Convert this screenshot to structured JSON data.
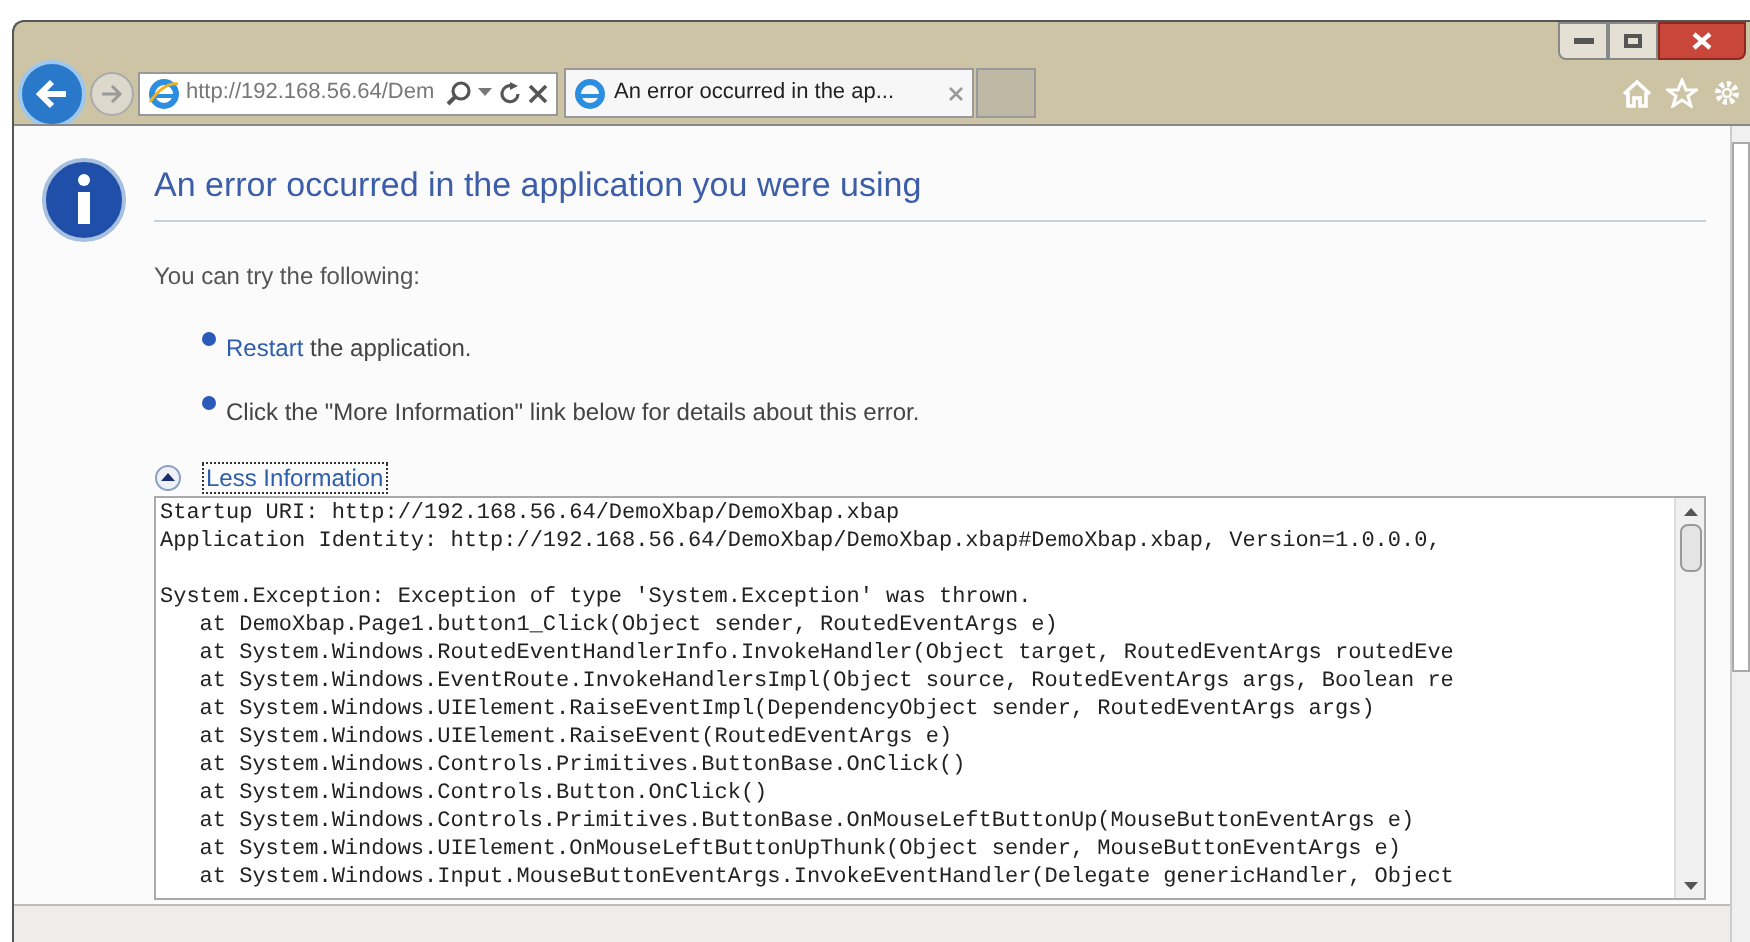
{
  "address_bar": {
    "url_host": "http://192.168.56.64/Dem"
  },
  "tabs": [
    {
      "label": "An error occurred in the ap...",
      "selected": true
    }
  ],
  "page": {
    "heading": "An error occurred in the application you were using",
    "intro": "You can try the following:",
    "suggestions": [
      {
        "link": "Restart",
        "text": " the application."
      },
      {
        "text": "Click the \"More Information\" link below for details about this error."
      }
    ],
    "toggle": {
      "label": "Less Information",
      "expanded": true
    },
    "details": [
      [
        "Startup URI: http://192.168.56.64/DemoXbap/DemoXbap.xbap",
        "Application Identity: http://192.168.56.64/DemoXbap/DemoXbap.xbap#DemoXbap.xbap, Version=1.0.0.0,"
      ],
      [
        "System.Exception: Exception of type 'System.Exception' was thrown.",
        "   at DemoXbap.Page1.button1_Click(Object sender, RoutedEventArgs e)",
        "   at System.Windows.RoutedEventHandlerInfo.InvokeHandler(Object target, RoutedEventArgs routedEve",
        "   at System.Windows.EventRoute.InvokeHandlersImpl(Object source, RoutedEventArgs args, Boolean re",
        "   at System.Windows.UIElement.RaiseEventImpl(DependencyObject sender, RoutedEventArgs args)",
        "   at System.Windows.UIElement.RaiseEvent(RoutedEventArgs e)",
        "   at System.Windows.Controls.Primitives.ButtonBase.OnClick()",
        "   at System.Windows.Controls.Button.OnClick()",
        "   at System.Windows.Controls.Primitives.ButtonBase.OnMouseLeftButtonUp(MouseButtonEventArgs e)",
        "   at System.Windows.UIElement.OnMouseLeftButtonUpThunk(Object sender, MouseButtonEventArgs e)",
        "   at System.Windows.Input.MouseButtonEventArgs.InvokeEventHandler(Delegate genericHandler, Object"
      ]
    ]
  }
}
